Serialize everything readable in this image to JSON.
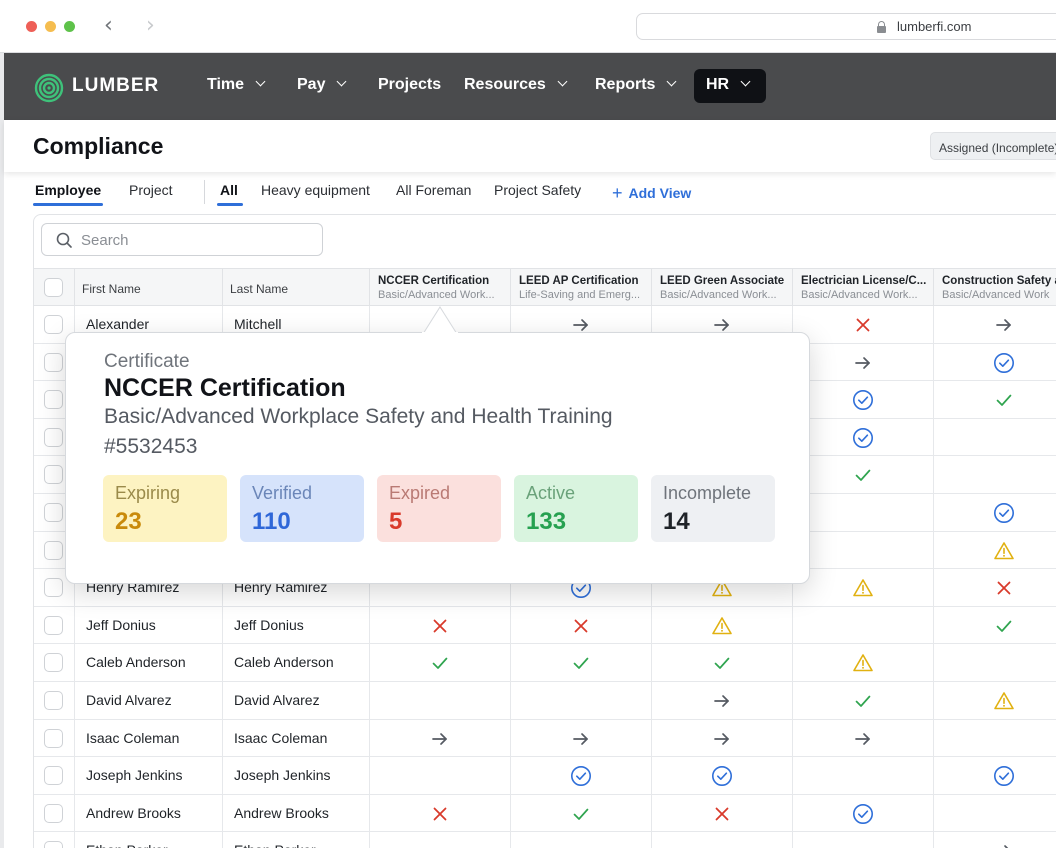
{
  "browser": {
    "url": "lumberfi.com"
  },
  "app": {
    "brand": "LUMBER",
    "nav": [
      {
        "label": "Time",
        "has_dropdown": true
      },
      {
        "label": "Pay",
        "has_dropdown": true
      },
      {
        "label": "Projects",
        "has_dropdown": false
      },
      {
        "label": "Resources",
        "has_dropdown": true
      },
      {
        "label": "Reports",
        "has_dropdown": true
      },
      {
        "label": "HR",
        "has_dropdown": true,
        "active": true
      }
    ]
  },
  "page": {
    "title": "Compliance",
    "assigned_filter": "Assigned (Incomplete)",
    "tabs": [
      {
        "label": "Employee",
        "active": true
      },
      {
        "label": "Project",
        "active": false
      }
    ],
    "views": [
      {
        "label": "All",
        "active": true
      },
      {
        "label": "Heavy equipment",
        "active": false
      },
      {
        "label": "All Foreman",
        "active": false
      },
      {
        "label": "Project Safety",
        "active": false
      }
    ],
    "add_view": "Add View",
    "search_placeholder": "Search"
  },
  "table": {
    "name_headers": [
      "First Name",
      "Last Name"
    ],
    "cert_columns": [
      {
        "title": "NCCER Certification",
        "subtitle": "Basic/Advanced Work..."
      },
      {
        "title": "LEED AP Certification",
        "subtitle": "Life-Saving and Emerg..."
      },
      {
        "title": "LEED Green Associate",
        "subtitle": "Basic/Advanced Work..."
      },
      {
        "title": "Electrician License/C...",
        "subtitle": "Basic/Advanced Work..."
      },
      {
        "title": "Construction Safety a",
        "subtitle": "Basic/Advanced Work"
      }
    ],
    "rows": [
      {
        "first": "Alexander",
        "last": "Mitchell",
        "status": [
          "",
          "arrow",
          "arrow",
          "x",
          "arrow"
        ]
      },
      {
        "first": "",
        "last": "",
        "status": [
          "",
          "",
          "",
          "arrow",
          "verified"
        ]
      },
      {
        "first": "",
        "last": "",
        "status": [
          "",
          "",
          "",
          "verified",
          "check"
        ]
      },
      {
        "first": "",
        "last": "",
        "status": [
          "",
          "",
          "",
          "verified",
          ""
        ]
      },
      {
        "first": "",
        "last": "",
        "status": [
          "",
          "",
          "",
          "check",
          ""
        ]
      },
      {
        "first": "",
        "last": "",
        "status": [
          "",
          "",
          "",
          "",
          "verified"
        ]
      },
      {
        "first": "",
        "last": "",
        "status": [
          "",
          "",
          "",
          "",
          "warn"
        ]
      },
      {
        "first": "Henry Ramirez",
        "last": "Henry Ramirez",
        "status": [
          "",
          "verified",
          "warn",
          "warn",
          "x"
        ]
      },
      {
        "first": "Jeff Donius",
        "last": "Jeff Donius",
        "status": [
          "x",
          "x",
          "warn",
          "",
          "check"
        ]
      },
      {
        "first": "Caleb Anderson",
        "last": "Caleb Anderson",
        "status": [
          "check",
          "check",
          "check",
          "warn",
          ""
        ]
      },
      {
        "first": "David Alvarez",
        "last": "David Alvarez",
        "status": [
          "",
          "",
          "arrow",
          "check",
          "warn"
        ]
      },
      {
        "first": "Isaac Coleman",
        "last": "Isaac Coleman",
        "status": [
          "arrow",
          "arrow",
          "arrow",
          "arrow",
          ""
        ]
      },
      {
        "first": "Joseph Jenkins",
        "last": "Joseph Jenkins",
        "status": [
          "",
          "verified",
          "verified",
          "",
          "verified"
        ]
      },
      {
        "first": "Andrew Brooks",
        "last": "Andrew Brooks",
        "status": [
          "x",
          "check",
          "x",
          "verified",
          ""
        ]
      },
      {
        "first": "Ethan Parker",
        "last": "Ethan Parker",
        "status": [
          "",
          "",
          "",
          "",
          "arrow"
        ]
      }
    ]
  },
  "popover": {
    "label": "Certificate",
    "title": "NCCER Certification",
    "subtitle": "Basic/Advanced Workplace Safety and Health Training",
    "number": "#5532453",
    "stats": [
      {
        "label": "Expiring",
        "value": "23",
        "bg": "#fdf3c2",
        "label_color": "#9a8a4a",
        "value_color": "#c98a0b"
      },
      {
        "label": "Verified",
        "value": "110",
        "bg": "#d6e3fb",
        "label_color": "#6b86b8",
        "value_color": "#2f67d8"
      },
      {
        "label": "Expired",
        "value": "5",
        "bg": "#fbe0dd",
        "label_color": "#b97a74",
        "value_color": "#d93a2b"
      },
      {
        "label": "Active",
        "value": "133",
        "bg": "#d9f4df",
        "label_color": "#6aa27a",
        "value_color": "#26a150"
      },
      {
        "label": "Incomplete",
        "value": "14",
        "bg": "#eef0f3",
        "label_color": "#6f747b",
        "value_color": "#1f2328"
      }
    ]
  },
  "colors": {
    "accent": "#2f6fd9",
    "nav_bg": "#4a4b4d",
    "check": "#2fa44f",
    "x": "#d93a2b",
    "warn": "#e1b111",
    "verified": "#2f6fd9",
    "arrow": "#555a62"
  },
  "icons": {
    "arrow": "arrow-right-icon",
    "x": "x-mark-icon",
    "check": "checkmark-icon",
    "verified": "verified-check-circle-icon",
    "warn": "warning-triangle-icon"
  }
}
